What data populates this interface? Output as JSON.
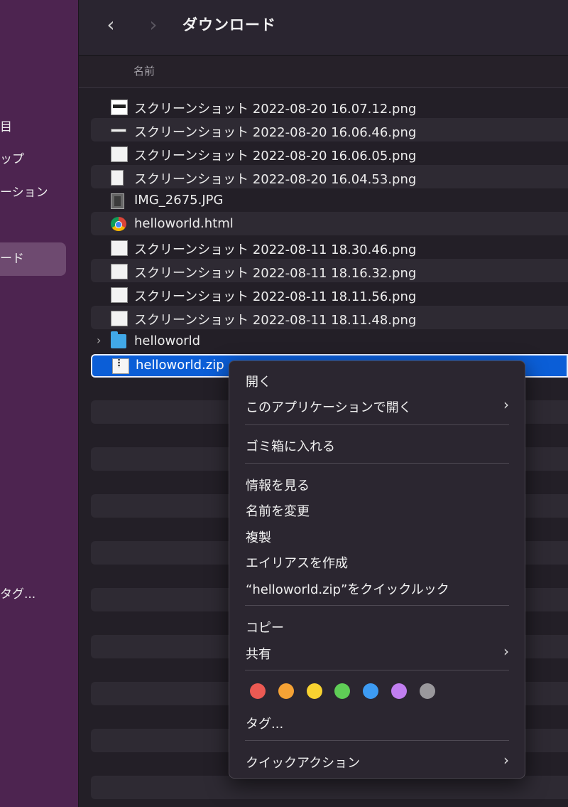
{
  "sidebar": {
    "items": [
      {
        "label": "目"
      },
      {
        "label": "ップ"
      },
      {
        "label": "ーション"
      },
      {
        "label": "ード",
        "selected": true
      },
      {
        "label": "タグ..."
      }
    ]
  },
  "toolbar": {
    "back_icon": "chevron-left-icon",
    "forward_icon": "chevron-right-icon",
    "back_glyph": "‹",
    "forward_glyph": "›",
    "title": "ダウンロード"
  },
  "columns": {
    "name": "名前"
  },
  "files": [
    {
      "name": "スクリーンショット 2022-08-20 16.07.12.png",
      "icon": "image-icon"
    },
    {
      "name": "スクリーンショット 2022-08-20 16.06.46.png",
      "icon": "image-icon"
    },
    {
      "name": "スクリーンショット 2022-08-20 16.06.05.png",
      "icon": "image-icon"
    },
    {
      "name": "スクリーンショット 2022-08-20 16.04.53.png",
      "icon": "image-icon"
    },
    {
      "name": "IMG_2675.JPG",
      "icon": "photo-icon"
    },
    {
      "name": "helloworld.html",
      "icon": "chrome-icon"
    },
    {
      "name": "スクリーンショット 2022-08-11 18.30.46.png",
      "icon": "image-icon"
    },
    {
      "name": "スクリーンショット 2022-08-11 18.16.32.png",
      "icon": "image-icon"
    },
    {
      "name": "スクリーンショット 2022-08-11 18.11.56.png",
      "icon": "image-icon"
    },
    {
      "name": "スクリーンショット 2022-08-11 18.11.48.png",
      "icon": "image-icon"
    },
    {
      "name": "helloworld",
      "icon": "folder-icon",
      "disclosure": "›"
    },
    {
      "name": "helloworld.zip",
      "icon": "zip-icon",
      "selected": true
    }
  ],
  "context_menu": {
    "open": "開く",
    "open_with": "このアプリケーションで開く",
    "trash": "ゴミ箱に入れる",
    "get_info": "情報を見る",
    "rename": "名前を変更",
    "duplicate": "複製",
    "make_alias": "エイリアスを作成",
    "quick_look": "“helloworld.zip”をクイックルック",
    "copy": "コピー",
    "share": "共有",
    "tags": "タグ...",
    "quick_actions": "クイックアクション",
    "submenu_glyph": "›",
    "tag_colors": [
      "#ec5a53",
      "#f5a235",
      "#f8d230",
      "#5fcd56",
      "#3d9bf3",
      "#c17ef0",
      "#9a989c"
    ]
  }
}
